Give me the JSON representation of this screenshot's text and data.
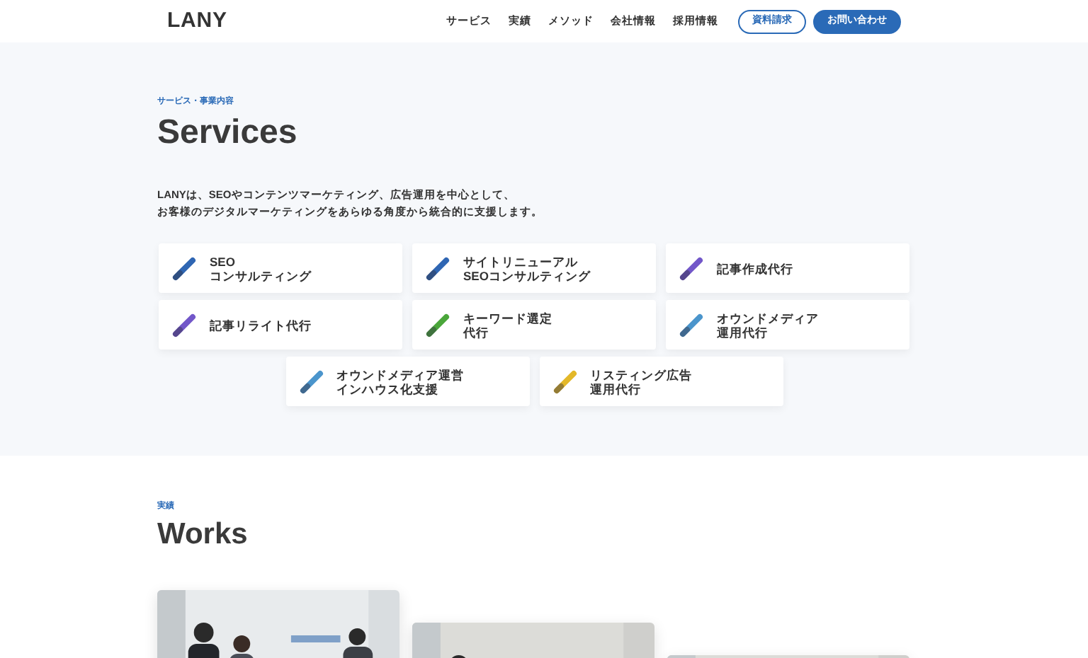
{
  "header": {
    "logo": "LANY",
    "nav": [
      "サービス",
      "実績",
      "メソッド",
      "会社情報",
      "採用情報"
    ],
    "buttons": [
      {
        "label": "資料請求",
        "kind": "outline"
      },
      {
        "label": "お問い合わせ",
        "kind": "filled"
      }
    ]
  },
  "services": {
    "eyebrow": "サービス・事業内容",
    "title": "Services",
    "description": [
      "LANYは、SEOやコンテンツマーケティング、広告運用を中心として、",
      "お客様のデジタルマーケティングをあらゆる角度から統合的に支援します。"
    ],
    "items": [
      {
        "lines": [
          "SEO",
          "コンサルティング"
        ],
        "color": "#2f66b3"
      },
      {
        "lines": [
          "サイトリニューアル",
          "SEOコンサルティング"
        ],
        "color": "#2f66b3"
      },
      {
        "lines": [
          "記事作成代行"
        ],
        "color": "#7257c9"
      },
      {
        "lines": [
          "記事リライト代行"
        ],
        "color": "#7257c9"
      },
      {
        "lines": [
          "キーワード選定",
          "代行"
        ],
        "color": "#4aa63a"
      },
      {
        "lines": [
          "オウンドメディア",
          "運用代行"
        ],
        "color": "#4b95cc"
      },
      {
        "lines": [
          "オウンドメディア運営",
          "インハウス化支援"
        ],
        "color": "#4b95cc"
      },
      {
        "lines": [
          "リスティング広告",
          "運用代行"
        ],
        "color": "#e3b829"
      }
    ]
  },
  "works": {
    "eyebrow": "実績",
    "title": "Works"
  }
}
